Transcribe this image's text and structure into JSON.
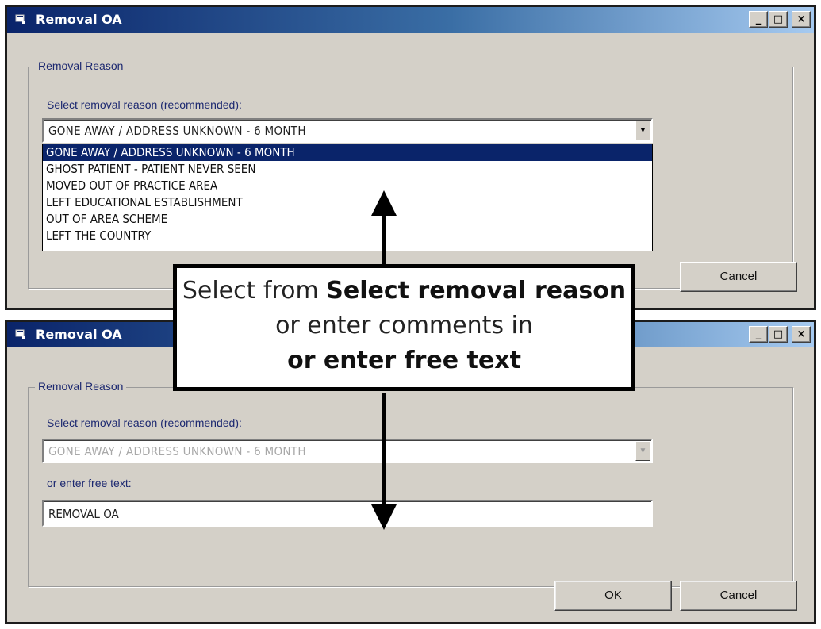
{
  "windows": [
    {
      "title": "Removal OA",
      "titlebar_buttons": {
        "minimize": "_",
        "maximize": "□",
        "close": "×"
      },
      "group_label": "Removal Reason",
      "select_label": "Select removal reason (recommended):",
      "combo_value": "GONE AWAY / ADDRESS UNKNOWN - 6 MONTH",
      "combo_arrow": "▼",
      "dropdown_open": true,
      "dropdown_items": [
        "GONE AWAY / ADDRESS UNKNOWN - 6 MONTH",
        "GHOST PATIENT - PATIENT NEVER SEEN",
        "MOVED OUT OF PRACTICE AREA",
        "LEFT EDUCATIONAL ESTABLISHMENT",
        "OUT OF AREA SCHEME",
        "LEFT THE COUNTRY"
      ],
      "selected_index": 0,
      "cancel_label": "Cancel"
    },
    {
      "title": "Removal OA",
      "titlebar_buttons": {
        "minimize": "_",
        "maximize": "□",
        "close": "×"
      },
      "group_label": "Removal Reason",
      "select_label": "Select removal reason (recommended):",
      "combo_value": "GONE AWAY / ADDRESS UNKNOWN - 6 MONTH",
      "combo_disabled": true,
      "combo_arrow": "▼",
      "free_text_label": "or enter free text:",
      "free_text_value": "REMOVAL OA",
      "ok_label": "OK",
      "cancel_label": "Cancel"
    }
  ],
  "callout": {
    "part1": "Select from ",
    "bold1": "Select removal reason",
    "part2": " or enter comments in ",
    "bold2": "or enter free text"
  },
  "colors": {
    "titlebar_start": "#0a246a",
    "titlebar_end": "#a6caf0",
    "window_bg": "#d4d0c8",
    "label_blue": "#1c2870",
    "selection": "#0a246a"
  },
  "icons": [
    "app-window-icon",
    "minimize-icon",
    "maximize-icon",
    "close-icon",
    "dropdown-arrow-icon",
    "arrow-up-icon",
    "arrow-down-icon"
  ]
}
